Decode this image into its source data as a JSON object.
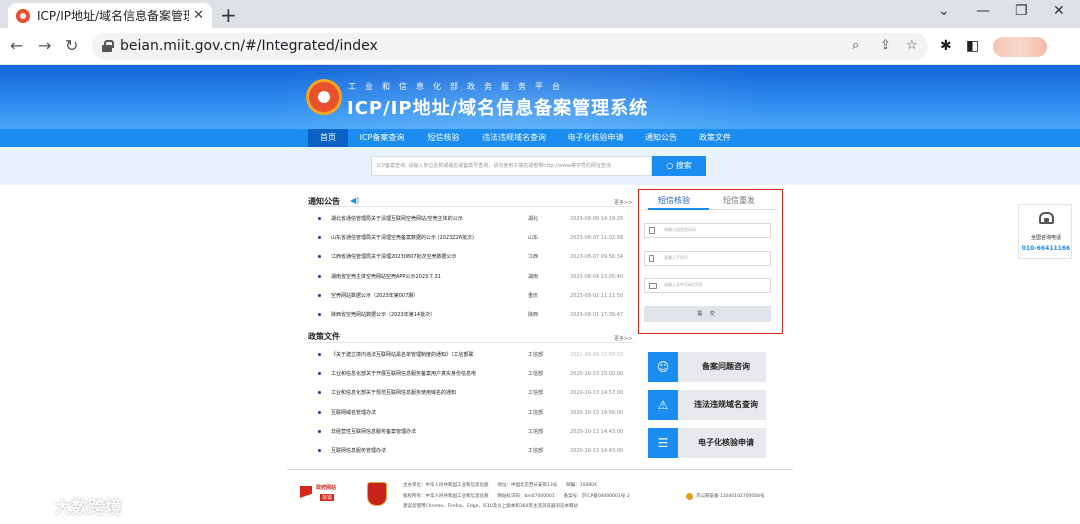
{
  "browser": {
    "tab_title": "ICP/IP地址/域名信息备案管理系",
    "url": "beian.miit.gov.cn/#/Integrated/index"
  },
  "header": {
    "subtitle": "工业和信息化部政务服务平台",
    "title": "ICP/IP地址/域名信息备案管理系统"
  },
  "nav": [
    {
      "label": "首页",
      "active": true
    },
    {
      "label": "ICP备案查询",
      "active": false
    },
    {
      "label": "短信核验",
      "active": false
    },
    {
      "label": "违法违规域名查询",
      "active": false
    },
    {
      "label": "电子化核验申请",
      "active": false
    },
    {
      "label": "通知公告",
      "active": false
    },
    {
      "label": "政策文件",
      "active": false
    }
  ],
  "search": {
    "label": "ICP备案查询:",
    "placeholder": "请输入单位名称或域名或备案号查询，请勿使用子域名或者带http://www等字符的网址查询",
    "button": "搜索"
  },
  "notices": {
    "heading": "通知公告",
    "more": "更多>>",
    "items": [
      {
        "title": "湖北省通信管理局关于清理互联网空壳网站/空壳主体的公示",
        "region": "湖北",
        "date": "2023-08-09 14:19:29"
      },
      {
        "title": "山东省通信管理局关于清理空壳备案数据的公示 (2023Z26批次)",
        "region": "山东",
        "date": "2023-08-07 11:02:58"
      },
      {
        "title": "江西省通信管理局关于清理20230807批次空壳数据公示",
        "region": "江西",
        "date": "2023-08-07 09:56:34"
      },
      {
        "title": "湖南省空壳主体空壳网站空壳APP公示2023.7.31",
        "region": "湖南",
        "date": "2023-08-04 13:05:40"
      },
      {
        "title": "空壳网站数据公示（2023年第007期）",
        "region": "重庆",
        "date": "2023-08-02 11:11:50"
      },
      {
        "title": "陕西省空壳网站数据公示（2023年第14批次）",
        "region": "陕西",
        "date": "2023-08-01 17:39:47"
      }
    ]
  },
  "policies": {
    "heading": "政策文件",
    "more": "更多>>",
    "items": [
      {
        "title": "《关于建立境内违法互联网站黑名单管理制度的通知》（工信部联",
        "region": "工信部",
        "date": "2021-08-09 15:50:22"
      },
      {
        "title": "工业和信息化部关于开展互联网信息服务备案用户真实身份信息电",
        "region": "工信部",
        "date": "2020-10-13 15:00:00"
      },
      {
        "title": "工业和信息化部关于规范互联网信息服务使用域名的通知",
        "region": "工信部",
        "date": "2020-10-13 14:57:00"
      },
      {
        "title": "互联网域名管理办法",
        "region": "工信部",
        "date": "2020-10-13 14:56:00"
      },
      {
        "title": "非经营性互联网信息服务备案管理办法",
        "region": "工信部",
        "date": "2020-10-13 14:43:00"
      },
      {
        "title": "互联网信息服务管理办法",
        "region": "工信部",
        "date": "2020-10-13 14:43:00"
      }
    ]
  },
  "sms": {
    "tab_verify": "短信核验",
    "tab_resend": "短信重发",
    "field_code": "请输入短信验证码",
    "field_phone": "请输入手机号",
    "field_id": "请输入证件号码后6位",
    "submit": "提 交"
  },
  "services": [
    {
      "label": "备案问题咨询",
      "icon": "chat-user-icon"
    },
    {
      "label": "违法违规域名查询",
      "icon": "warning-icon"
    },
    {
      "label": "电子化核验申请",
      "icon": "form-icon"
    }
  ],
  "hotline": {
    "label": "全国咨询电话",
    "number": "010-66411166"
  },
  "footer": {
    "gov_text": "政府网站",
    "gov_sub": "找错",
    "line1": "主办单位：中华人民共和国工业和信息化部　　地址：中国北京西长安街13号　　邮编：100804",
    "line2": "版权所有：中华人民共和国工业和信息化部　　网站标识码：bm07000001　　备案号：京ICP备04000001号-2",
    "police": "京公网安备 11040102700068号",
    "line3": "建议您使用Chrome、Firefox、Edge、IE10及以上版本和360等主流浏览器浏览本网站"
  },
  "watermark": {
    "text": "大数跨境"
  }
}
